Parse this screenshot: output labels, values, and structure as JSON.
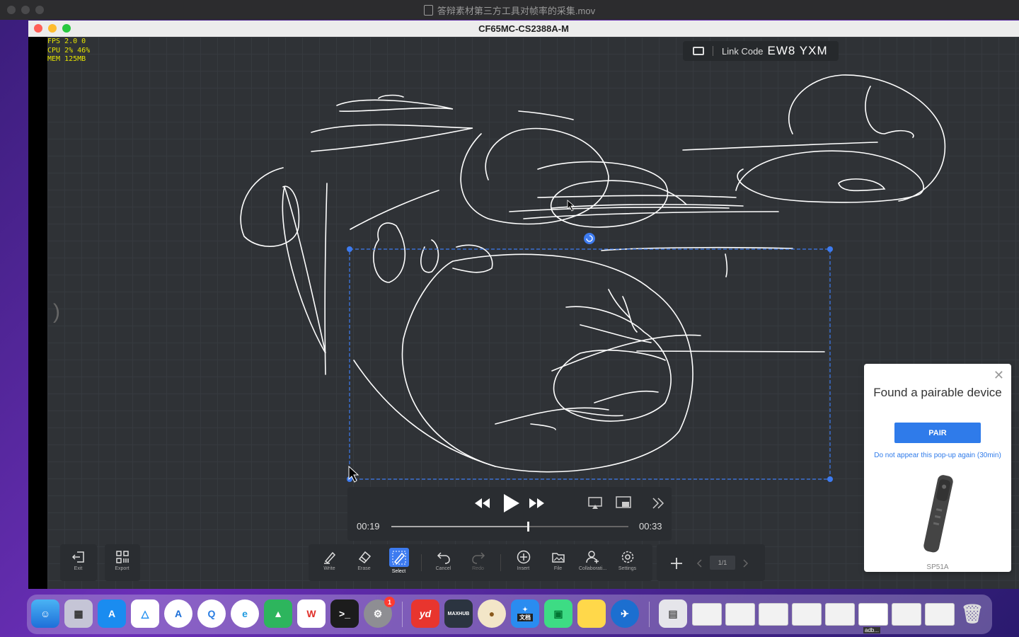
{
  "outer_window": {
    "title": "答辩素材第三方工具对帧率的采集.mov"
  },
  "window": {
    "title": "CF65MC-CS2388A-M"
  },
  "stats": {
    "fps": "FPS   2.0   0",
    "cpu": "CPU   2%  46%",
    "mem": "MEM  125MB"
  },
  "link": {
    "label": "Link Code",
    "code": "EW8 YXM"
  },
  "player": {
    "current": "00:19",
    "total": "00:33",
    "progress": 0.575
  },
  "left_toolbar": {
    "exit": "Exit",
    "export": "Export"
  },
  "toolbar": {
    "write": "Write",
    "erase": "Erase",
    "select": "Select",
    "cancel": "Cancel",
    "redo": "Redo",
    "insert": "Insert",
    "file": "File",
    "collab": "Collaborati...",
    "settings": "Settings"
  },
  "pager": {
    "page": "1/1"
  },
  "popup": {
    "title": "Found a pairable device",
    "pair_label": "PAIR",
    "dismiss": "Do not appear this pop-up again (30min)",
    "device_model": "SP51A"
  },
  "dock": {
    "settings_badge": "1",
    "yd_label": "yd",
    "maxhub_label": "MAXHUB",
    "doc_label": "文档",
    "adb_label": "adb..."
  },
  "colors": {
    "selection": "#3d7bf0",
    "canvas": "#2f3236",
    "accent": "#2f7bea"
  }
}
